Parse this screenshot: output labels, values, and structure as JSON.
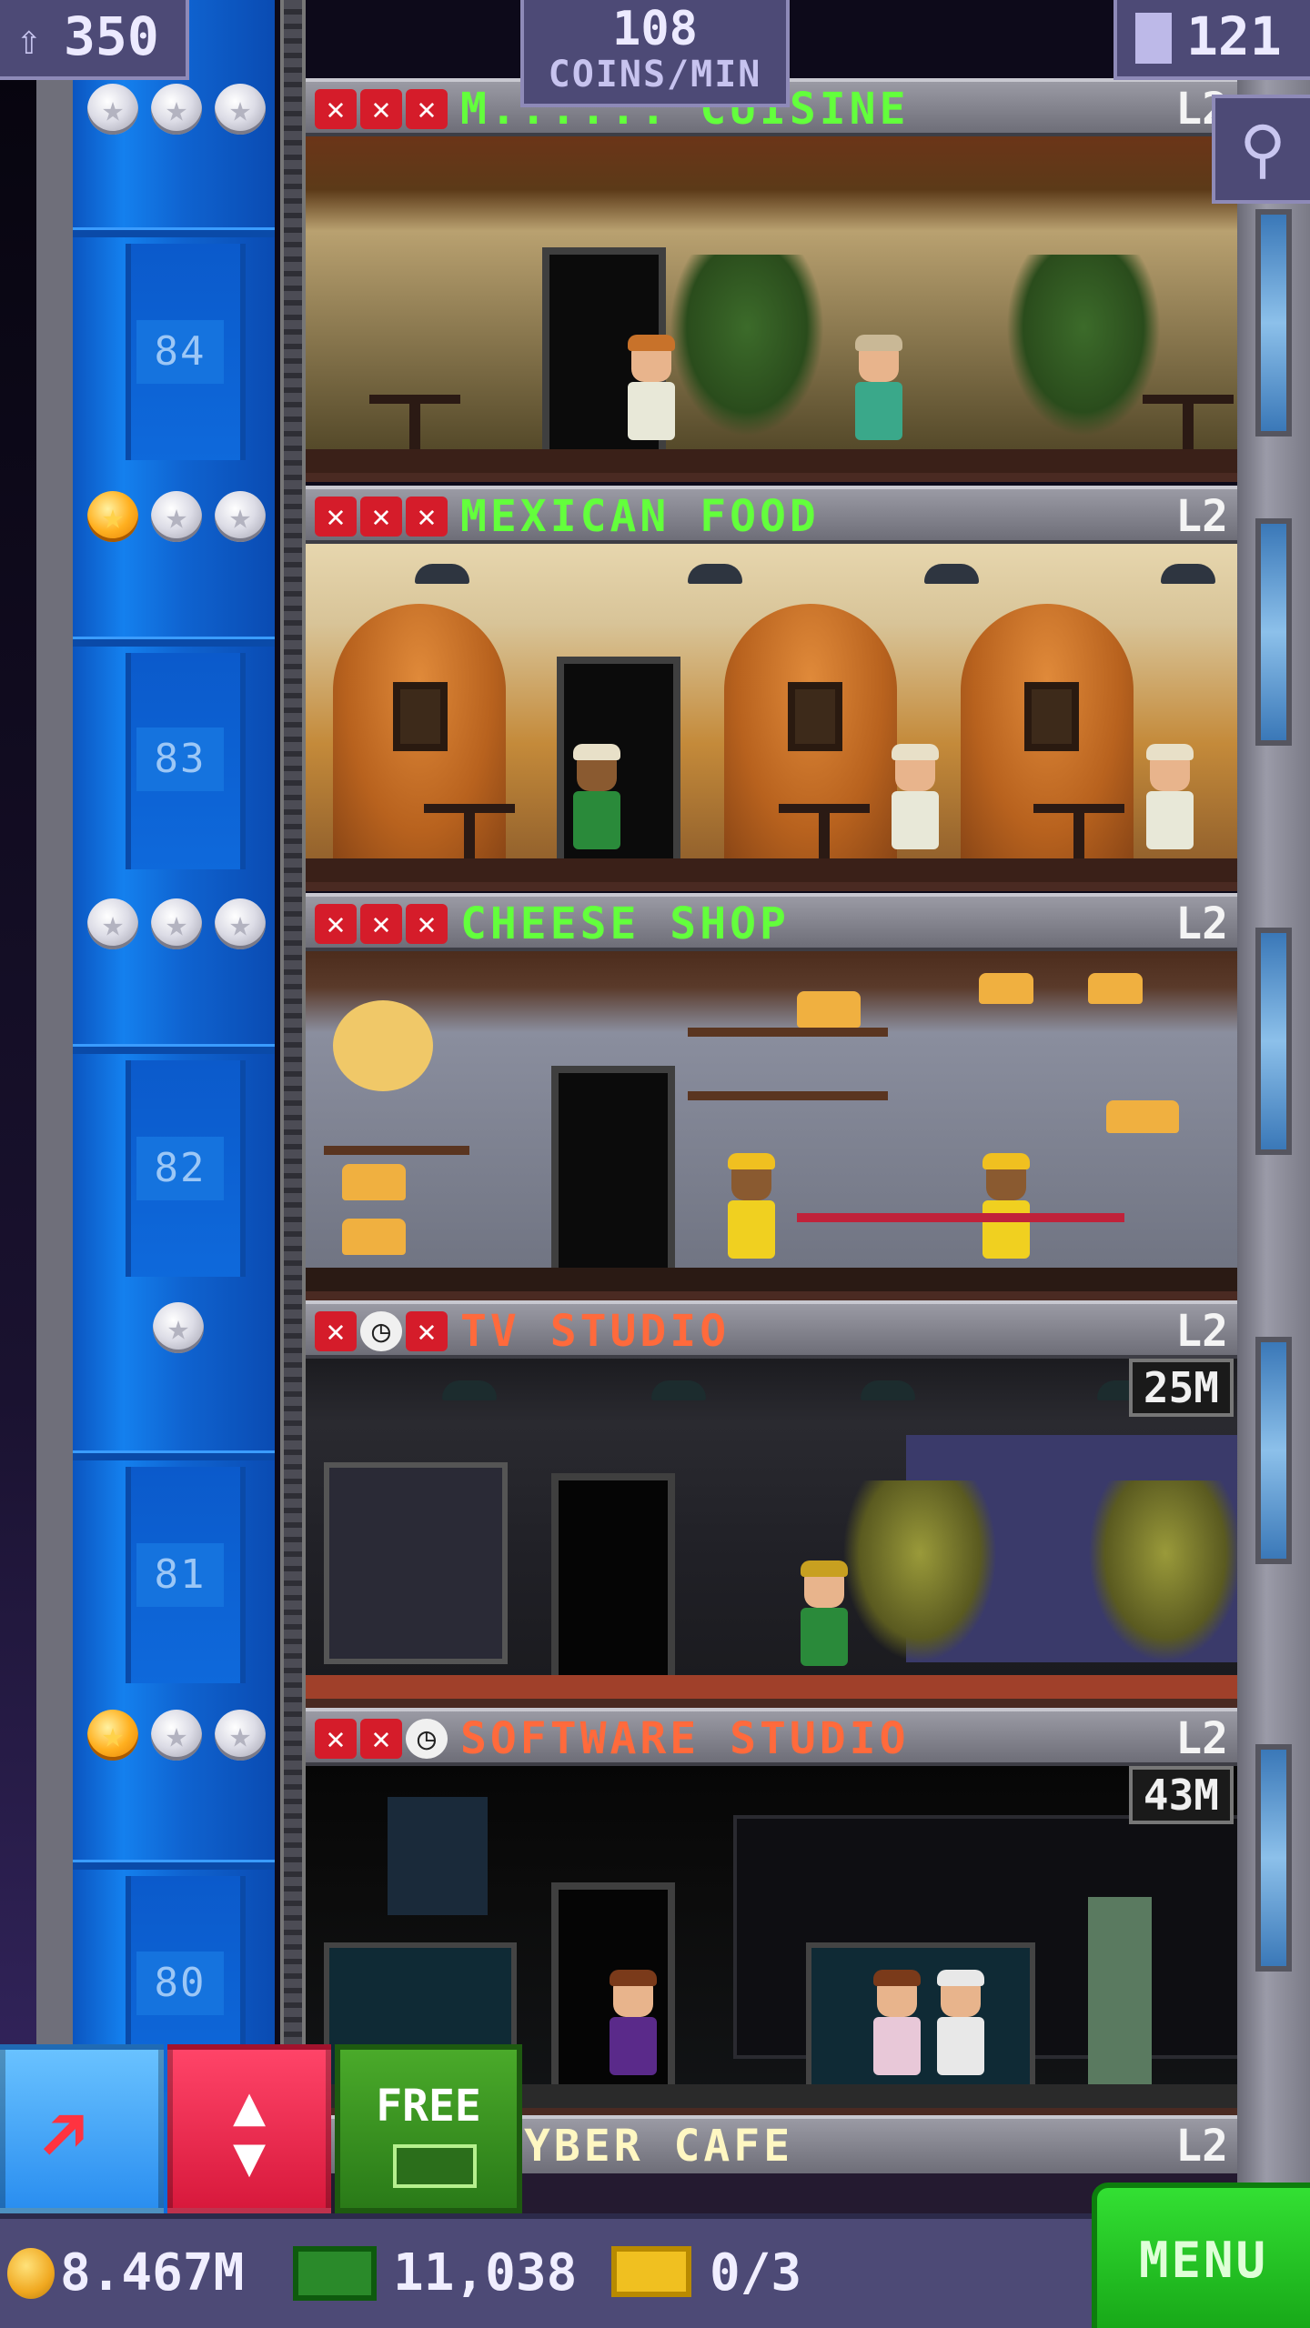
{
  "hud": {
    "population": "350",
    "coins_per_min_value": "108",
    "coins_per_min_label": "COINS/MIN",
    "floor_count": "121"
  },
  "floors": [
    {
      "number": "84",
      "name": "M...... CUISINE",
      "level": "L2",
      "stars": [
        "silver",
        "silver",
        "silver"
      ],
      "status": [
        "x",
        "x",
        "x"
      ],
      "timer": ""
    },
    {
      "number": "83",
      "name": "MEXICAN FOOD",
      "level": "L2",
      "stars": [
        "gold",
        "silver",
        "silver"
      ],
      "status": [
        "x",
        "x",
        "x"
      ],
      "timer": ""
    },
    {
      "number": "82",
      "name": "CHEESE SHOP",
      "level": "L2",
      "stars": [
        "silver",
        "silver",
        "silver"
      ],
      "status": [
        "x",
        "x",
        "x"
      ],
      "timer": ""
    },
    {
      "number": "81",
      "name": "TV STUDIO",
      "level": "L2",
      "stars": [
        "silver"
      ],
      "status": [
        "x",
        "clock",
        "x"
      ],
      "timer": "25M"
    },
    {
      "number": "80",
      "name": "SOFTWARE STUDIO",
      "level": "L2",
      "stars": [
        "gold",
        "silver",
        "silver"
      ],
      "status": [
        "x",
        "x",
        "clock"
      ],
      "timer": "43M"
    }
  ],
  "partial_floor": {
    "name": "YBER CAFE",
    "level": "L2"
  },
  "actions": {
    "free_label": "FREE"
  },
  "currency": {
    "coins": "8.467M",
    "bux": "11,038",
    "tickets": "0/3"
  },
  "menu_label": "MENU",
  "colors": {
    "elevator_blue": "#1480ee",
    "name_ready": "#63ff3c",
    "name_busy": "#ff6a3c",
    "menu_green": "#24c424",
    "hud_purple": "#4d4a76"
  },
  "icons": {
    "population": "person-up-icon",
    "floors": "building-icon",
    "search": "magnifier-icon",
    "move": "pixel-arrow-icon",
    "elevator": "up-down-arrows-icon",
    "bux": "bux-bill-icon",
    "coin": "coin-icon",
    "ticket": "golden-ticket-icon"
  }
}
